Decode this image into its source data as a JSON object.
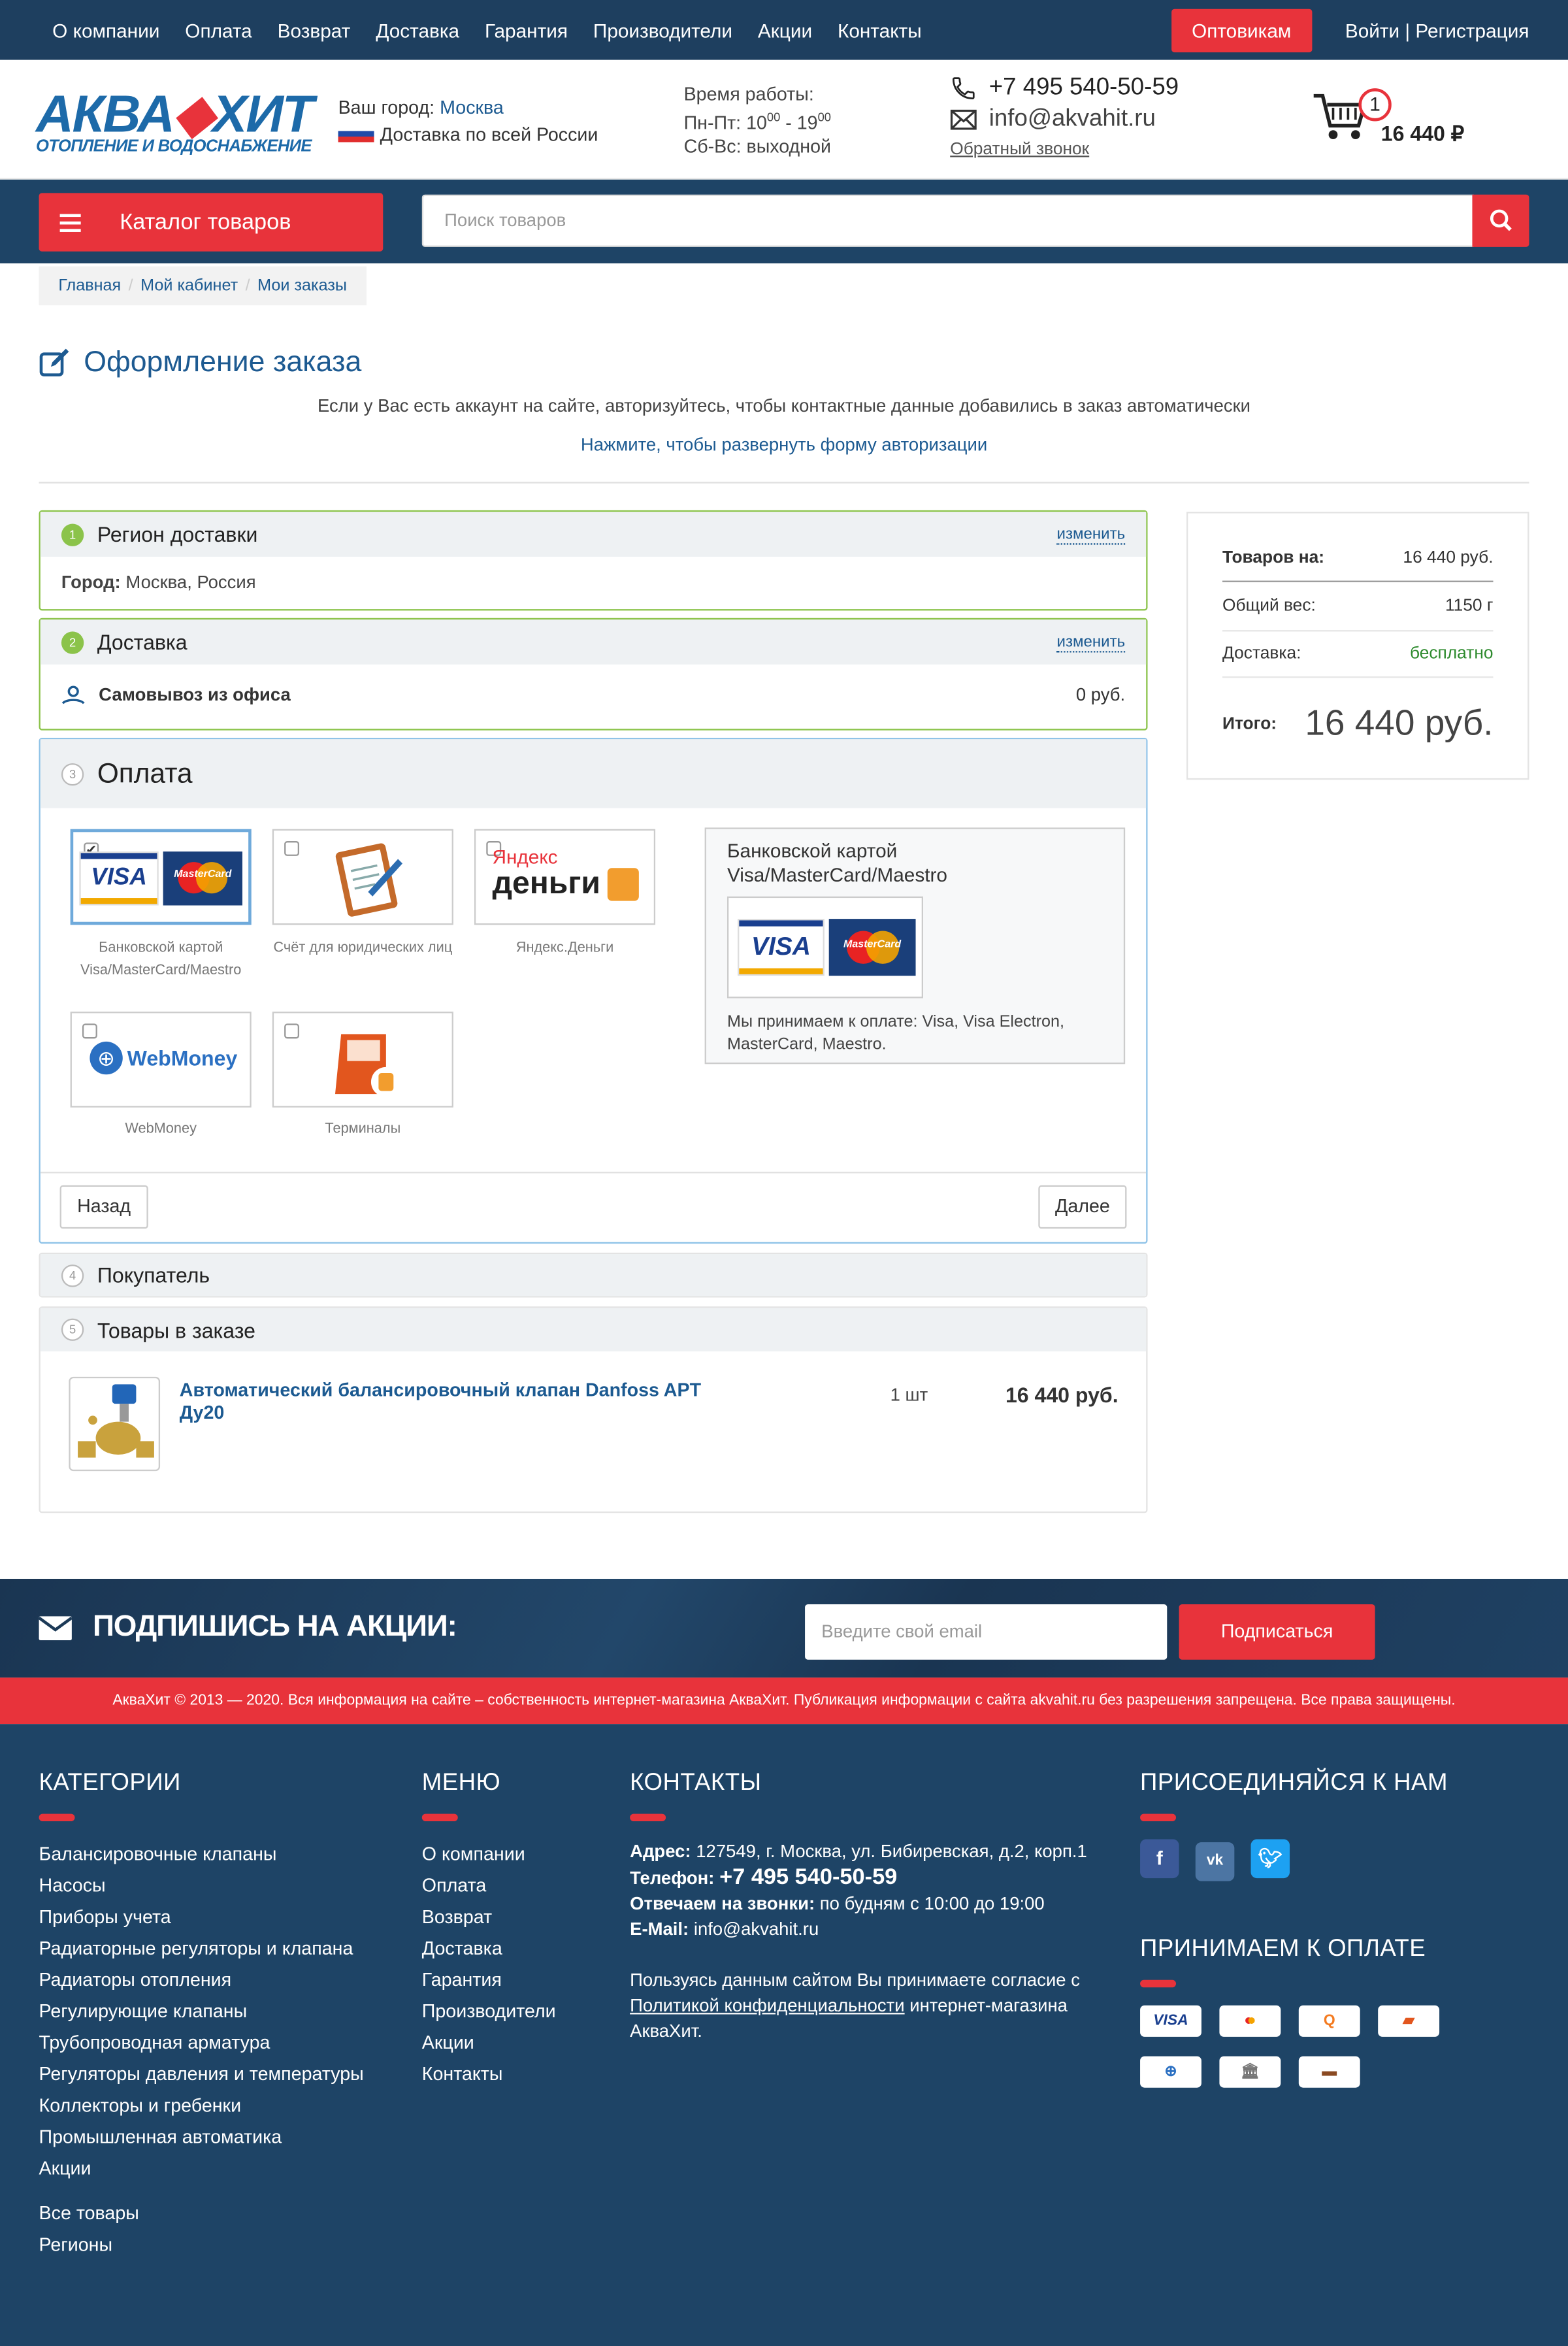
{
  "topnav": {
    "items": [
      "О компании",
      "Оплата",
      "Возврат",
      "Доставка",
      "Гарантия",
      "Производители",
      "Акции",
      "Контакты"
    ],
    "wholesale": "Оптовикам",
    "login": "Войти | Регистрация"
  },
  "header": {
    "logo_main_1": "АКВА",
    "logo_main_2": "ХИТ",
    "logo_sub": "ОТОПЛЕНИЕ И ВОДОСНАБЖЕНИЕ",
    "city_label": "Ваш город:",
    "city": "Москва",
    "delivery": "Доставка по всей России",
    "hours_title": "Время работы:",
    "hours_weekdays_prefix": "Пн-Пт: 10",
    "hours_weekdays_sup1": "00",
    "hours_weekdays_mid": " - 19",
    "hours_weekdays_sup2": "00",
    "hours_weekend": "Сб-Вс: выходной",
    "phone": "+7 495 540-50-59",
    "email": "info@akvahit.ru",
    "callback": "Обратный звонок",
    "cart_count": "1",
    "cart_sum": "16 440 ₽"
  },
  "catalog_button": "Каталог товаров",
  "search": {
    "placeholder": "Поиск товаров"
  },
  "breadcrumbs": [
    "Главная",
    "Мой кабинет",
    "Мои заказы"
  ],
  "page": {
    "title": "Оформление заказа",
    "auth_note": "Если у Вас есть аккаунт на сайте, авторизуйтесь, чтобы контактные данные добавились в заказ автоматически",
    "auth_link": "Нажмите, чтобы развернуть форму авторизации"
  },
  "steps": {
    "region": {
      "num": "1",
      "title": "Регион доставки",
      "change": "изменить",
      "city_label": "Город:",
      "city_value": "Москва, Россия"
    },
    "delivery": {
      "num": "2",
      "title": "Доставка",
      "change": "изменить",
      "method": "Самовывоз из офиса",
      "price": "0 руб."
    },
    "payment": {
      "num": "3",
      "title": "Оплата",
      "options": [
        {
          "label": "Банковской картой Visa/MasterCard/Maestro",
          "selected": true
        },
        {
          "label": "Счёт для юридических лиц",
          "selected": false
        },
        {
          "label": "Яндекс.Деньги",
          "selected": false
        },
        {
          "label": "WebMoney",
          "selected": false
        },
        {
          "label": "Терминалы",
          "selected": false
        }
      ],
      "info_title": "Банковской картой Visa/MasterCard/Maestro",
      "info_text": "Мы принимаем к оплате: Visa, Visa Electron, MasterCard, Maestro.",
      "back": "Назад",
      "next": "Далее",
      "visa": "VISA",
      "mastercard": "MasterCard",
      "yandex_1": "Яндекс",
      "yandex_2": "деньги",
      "webmoney": "WebMoney"
    },
    "buyer": {
      "num": "4",
      "title": "Покупатель"
    },
    "items": {
      "num": "5",
      "title": "Товары в заказе",
      "product": {
        "name": "Автоматический балансировочный клапан Danfoss APT Ду20",
        "qty": "1 шт",
        "price": "16 440 руб."
      }
    }
  },
  "summary": {
    "rows": [
      {
        "label": "Товаров на:",
        "value": "16 440 руб."
      },
      {
        "label": "Общий вес:",
        "value": "1150 г"
      },
      {
        "label": "Доставка:",
        "value": "бесплатно"
      }
    ],
    "total_label": "Итого:",
    "total": "16 440 руб."
  },
  "promo": {
    "title": "ПОДПИШИСЬ НА АКЦИИ:",
    "placeholder": "Введите свой email",
    "button": "Подписаться"
  },
  "copyright": "АкваХит © 2013 — 2020. Вся информация на сайте – собственность интернет-магазина АкваХит. Публикация информации с сайта akvahit.ru без разрешения запрещена. Все права защищены.",
  "footer": {
    "categories_title": "КАТЕГОРИИ",
    "categories": [
      "Балансировочные клапаны",
      "Насосы",
      "Приборы учета",
      "Радиаторные регуляторы и клапана",
      "Радиаторы отопления",
      "Регулирующие клапаны",
      "Трубопроводная арматура",
      "Регуляторы давления и температуры",
      "Коллекторы и гребенки",
      "Промышленная автоматика",
      "Акции"
    ],
    "extra": [
      "Все товары",
      "Регионы"
    ],
    "menu_title": "МЕНЮ",
    "menu": [
      "О компании",
      "Оплата",
      "Возврат",
      "Доставка",
      "Гарантия",
      "Производители",
      "Акции",
      "Контакты"
    ],
    "contacts_title": "КОНТАКТЫ",
    "address_label": "Адрес:",
    "address": "127549, г. Москва, ул. Бибиревская, д.2, корп.1",
    "phone_label": "Телефон:",
    "phone": "+7 495 540-50-59",
    "hours_label": "Отвечаем на звонки:",
    "hours": "по будням с 10:00 до 19:00",
    "email_label": "E-Mail:",
    "email": "info@akvahit.ru",
    "policy_1": "Пользуясь данным сайтом Вы принимаете согласие с",
    "policy_link": "Политикой конфиденциальности",
    "policy_2": "интернет-магазина АкваХит.",
    "social_title": "ПРИСОЕДИНЯЙСЯ К НАМ",
    "pay_title": "ПРИНИМАЕМ К ОПЛАТЕ"
  },
  "colors": {
    "brand_blue": "#1e4466",
    "accent_red": "#e8333b",
    "step_green": "#8bc34a",
    "link": "#1c5a91"
  }
}
